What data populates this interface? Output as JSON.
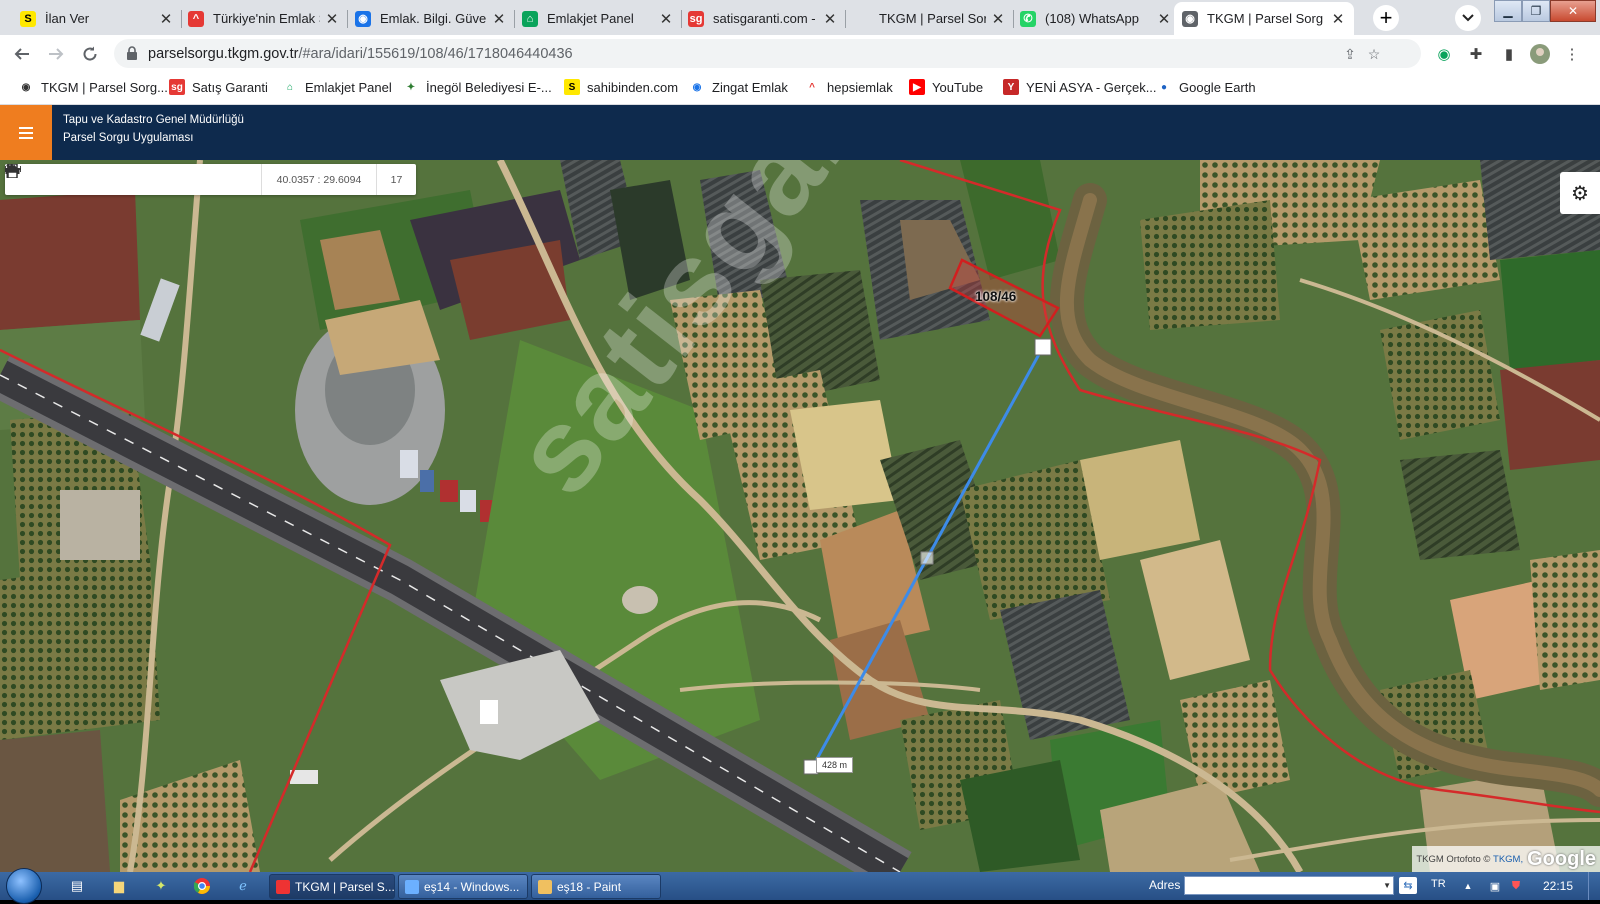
{
  "tabs": [
    {
      "title": "İlan Ver",
      "favicon": "sahibinden-icon",
      "color": "#ffe800",
      "glyph": "S"
    },
    {
      "title": "Türkiye'nin Emlak S",
      "favicon": "emlakjet-roof-icon",
      "color": "#e53935",
      "glyph": "^"
    },
    {
      "title": "Emlak. Bilgi. Güven",
      "favicon": "location-pin-icon",
      "color": "#1a73e8",
      "glyph": "◉"
    },
    {
      "title": "Emlakjet Panel",
      "favicon": "emlakjet-house-icon",
      "color": "#0aa35b",
      "glyph": "⌂"
    },
    {
      "title": "satisgaranti.com -",
      "favicon": "satisgaranti-icon",
      "color": "#e53935",
      "glyph": "sg"
    },
    {
      "title": "TKGM | Parsel Sorg",
      "favicon": "blank-icon",
      "color": "#dee1e6",
      "glyph": ""
    },
    {
      "title": "(108) WhatsApp",
      "favicon": "whatsapp-icon",
      "color": "#25d366",
      "glyph": "✆"
    },
    {
      "title": "TKGM | Parsel Sorg",
      "favicon": "location-pin-icon",
      "color": "#5f6368",
      "glyph": "◉"
    }
  ],
  "url": {
    "host": "parselsorgu.tkgm.gov.tr",
    "path": "/#ara/idari/155619/108/46/1718046440436"
  },
  "bookmarks": [
    {
      "label": "TKGM | Parsel Sorg...",
      "icon": "location-pin-icon",
      "color": "#333333",
      "glyph": "◉"
    },
    {
      "label": "Satış Garanti",
      "icon": "satisgaranti-icon",
      "color": "#e53935",
      "glyph": "sg"
    },
    {
      "label": "Emlakjet Panel",
      "icon": "emlakjet-house-icon",
      "color": "#0aa35b",
      "glyph": "⌂"
    },
    {
      "label": "İnegöl Belediyesi E-...",
      "icon": "inegol-icon",
      "color": "#2e7d32",
      "glyph": "✦"
    },
    {
      "label": "sahibinden.com",
      "icon": "sahibinden-icon",
      "color": "#ffe800",
      "glyph": "S"
    },
    {
      "label": "Zingat Emlak",
      "icon": "location-pin-icon",
      "color": "#1a73e8",
      "glyph": "◉"
    },
    {
      "label": "hepsiemlak",
      "icon": "hepsiemlak-roof-icon",
      "color": "#e53935",
      "glyph": "^"
    },
    {
      "label": "YouTube",
      "icon": "youtube-icon",
      "color": "#ff0000",
      "glyph": "▶"
    },
    {
      "label": "YENİ ASYA - Gerçek...",
      "icon": "yeni-asya-icon",
      "color": "#c62828",
      "glyph": "Y"
    },
    {
      "label": "Google Earth",
      "icon": "google-earth-icon",
      "color": "#1e63c4",
      "glyph": "●"
    }
  ],
  "app": {
    "title": "Tapu ve Kadastro Genel Müdürlüğü",
    "subtitle": "Parsel Sorgu Uygulaması",
    "accent": "#ef7d1f",
    "header_bg": "#0e2a4d"
  },
  "map": {
    "coords": "40.0357 : 29.6094",
    "zoom": "17",
    "parcel_label": "108/46",
    "distance": "428 m",
    "attribution": "TKGM Ortofoto ©",
    "attribution_link": "TKGM,",
    "google": "Google",
    "watermark": "satisgaranti.com",
    "boundary_color": "#d42a2a",
    "measure_color": "#3d8be8"
  },
  "taskbar": {
    "tasks": [
      {
        "label": "TKGM | Parsel S...",
        "icon": "chrome-icon"
      },
      {
        "label": "eş14 - Windows...",
        "icon": "photo-viewer-icon"
      },
      {
        "label": "eş18 - Paint",
        "icon": "paint-icon"
      }
    ],
    "address_label": "Adres",
    "lang": "TR",
    "clock": "22:15"
  }
}
